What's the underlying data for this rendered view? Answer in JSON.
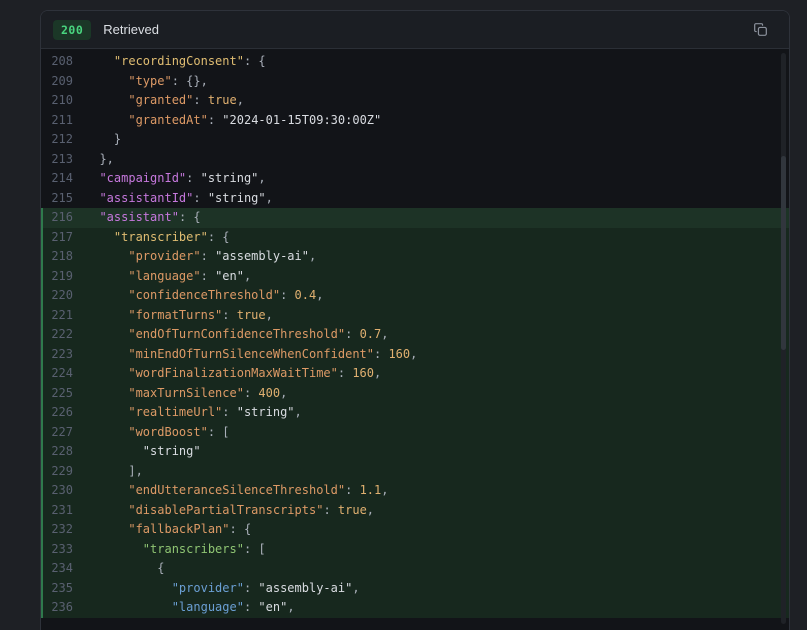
{
  "header": {
    "status_code": "200",
    "status_label": "Retrieved",
    "copy_icon": "copy-icon"
  },
  "colors": {
    "status_green": "#49d57f",
    "badge_bg": "#1b3727",
    "panel_bg": "#121418",
    "header_bg": "#1b1e23",
    "highlight_bg": "#17281e",
    "highlight_first_bg": "#1d3326",
    "highlight_accent": "#2f7a4c",
    "key_level_1": "#c678dd",
    "key_level_2": "#e0bd72",
    "key_level_3": "#dd9a66",
    "key_level_4": "#8fc573",
    "key_level_6": "#6b9fd4",
    "string_value": "#d9dce1",
    "number_value": "#e0b070",
    "punctuation": "#a9afb9",
    "line_number": "#596070"
  },
  "code": {
    "lines": [
      {
        "n": "208",
        "ind": 4,
        "hl": false,
        "first": false,
        "toks": [
          [
            "k2",
            "\"recordingConsent\""
          ],
          [
            "p",
            ": {"
          ]
        ]
      },
      {
        "n": "209",
        "ind": 6,
        "hl": false,
        "first": false,
        "toks": [
          [
            "k3",
            "\"type\""
          ],
          [
            "p",
            ": {},"
          ]
        ]
      },
      {
        "n": "210",
        "ind": 6,
        "hl": false,
        "first": false,
        "toks": [
          [
            "k3",
            "\"granted\""
          ],
          [
            "p",
            ": "
          ],
          [
            "b",
            "true"
          ],
          [
            "p",
            ","
          ]
        ]
      },
      {
        "n": "211",
        "ind": 6,
        "hl": false,
        "first": false,
        "toks": [
          [
            "k3",
            "\"grantedAt\""
          ],
          [
            "p",
            ": "
          ],
          [
            "s",
            "\"2024-01-15T09:30:00Z\""
          ]
        ]
      },
      {
        "n": "212",
        "ind": 4,
        "hl": false,
        "first": false,
        "toks": [
          [
            "p",
            "}"
          ]
        ]
      },
      {
        "n": "213",
        "ind": 2,
        "hl": false,
        "first": false,
        "toks": [
          [
            "p",
            "},"
          ]
        ]
      },
      {
        "n": "214",
        "ind": 2,
        "hl": false,
        "first": false,
        "toks": [
          [
            "k1",
            "\"campaignId\""
          ],
          [
            "p",
            ": "
          ],
          [
            "s",
            "\"string\""
          ],
          [
            "p",
            ","
          ]
        ]
      },
      {
        "n": "215",
        "ind": 2,
        "hl": false,
        "first": false,
        "toks": [
          [
            "k1",
            "\"assistantId\""
          ],
          [
            "p",
            ": "
          ],
          [
            "s",
            "\"string\""
          ],
          [
            "p",
            ","
          ]
        ]
      },
      {
        "n": "216",
        "ind": 2,
        "hl": true,
        "first": true,
        "toks": [
          [
            "k1",
            "\"assistant\""
          ],
          [
            "p",
            ": {"
          ]
        ]
      },
      {
        "n": "217",
        "ind": 4,
        "hl": true,
        "first": false,
        "toks": [
          [
            "k2",
            "\"transcriber\""
          ],
          [
            "p",
            ": {"
          ]
        ]
      },
      {
        "n": "218",
        "ind": 6,
        "hl": true,
        "first": false,
        "toks": [
          [
            "k3",
            "\"provider\""
          ],
          [
            "p",
            ": "
          ],
          [
            "s",
            "\"assembly-ai\""
          ],
          [
            "p",
            ","
          ]
        ]
      },
      {
        "n": "219",
        "ind": 6,
        "hl": true,
        "first": false,
        "toks": [
          [
            "k3",
            "\"language\""
          ],
          [
            "p",
            ": "
          ],
          [
            "s",
            "\"en\""
          ],
          [
            "p",
            ","
          ]
        ]
      },
      {
        "n": "220",
        "ind": 6,
        "hl": true,
        "first": false,
        "toks": [
          [
            "k3",
            "\"confidenceThreshold\""
          ],
          [
            "p",
            ": "
          ],
          [
            "n",
            "0.4"
          ],
          [
            "p",
            ","
          ]
        ]
      },
      {
        "n": "221",
        "ind": 6,
        "hl": true,
        "first": false,
        "toks": [
          [
            "k3",
            "\"formatTurns\""
          ],
          [
            "p",
            ": "
          ],
          [
            "b",
            "true"
          ],
          [
            "p",
            ","
          ]
        ]
      },
      {
        "n": "222",
        "ind": 6,
        "hl": true,
        "first": false,
        "toks": [
          [
            "k3",
            "\"endOfTurnConfidenceThreshold\""
          ],
          [
            "p",
            ": "
          ],
          [
            "n",
            "0.7"
          ],
          [
            "p",
            ","
          ]
        ]
      },
      {
        "n": "223",
        "ind": 6,
        "hl": true,
        "first": false,
        "toks": [
          [
            "k3",
            "\"minEndOfTurnSilenceWhenConfident\""
          ],
          [
            "p",
            ": "
          ],
          [
            "n",
            "160"
          ],
          [
            "p",
            ","
          ]
        ]
      },
      {
        "n": "224",
        "ind": 6,
        "hl": true,
        "first": false,
        "toks": [
          [
            "k3",
            "\"wordFinalizationMaxWaitTime\""
          ],
          [
            "p",
            ": "
          ],
          [
            "n",
            "160"
          ],
          [
            "p",
            ","
          ]
        ]
      },
      {
        "n": "225",
        "ind": 6,
        "hl": true,
        "first": false,
        "toks": [
          [
            "k3",
            "\"maxTurnSilence\""
          ],
          [
            "p",
            ": "
          ],
          [
            "n",
            "400"
          ],
          [
            "p",
            ","
          ]
        ]
      },
      {
        "n": "226",
        "ind": 6,
        "hl": true,
        "first": false,
        "toks": [
          [
            "k3",
            "\"realtimeUrl\""
          ],
          [
            "p",
            ": "
          ],
          [
            "s",
            "\"string\""
          ],
          [
            "p",
            ","
          ]
        ]
      },
      {
        "n": "227",
        "ind": 6,
        "hl": true,
        "first": false,
        "toks": [
          [
            "k3",
            "\"wordBoost\""
          ],
          [
            "p",
            ": ["
          ]
        ]
      },
      {
        "n": "228",
        "ind": 8,
        "hl": true,
        "first": false,
        "toks": [
          [
            "s",
            "\"string\""
          ]
        ]
      },
      {
        "n": "229",
        "ind": 6,
        "hl": true,
        "first": false,
        "toks": [
          [
            "p",
            "],"
          ]
        ]
      },
      {
        "n": "230",
        "ind": 6,
        "hl": true,
        "first": false,
        "toks": [
          [
            "k3",
            "\"endUtteranceSilenceThreshold\""
          ],
          [
            "p",
            ": "
          ],
          [
            "n",
            "1.1"
          ],
          [
            "p",
            ","
          ]
        ]
      },
      {
        "n": "231",
        "ind": 6,
        "hl": true,
        "first": false,
        "toks": [
          [
            "k3",
            "\"disablePartialTranscripts\""
          ],
          [
            "p",
            ": "
          ],
          [
            "b",
            "true"
          ],
          [
            "p",
            ","
          ]
        ]
      },
      {
        "n": "232",
        "ind": 6,
        "hl": true,
        "first": false,
        "toks": [
          [
            "k3",
            "\"fallbackPlan\""
          ],
          [
            "p",
            ": {"
          ]
        ]
      },
      {
        "n": "233",
        "ind": 8,
        "hl": true,
        "first": false,
        "toks": [
          [
            "k4",
            "\"transcribers\""
          ],
          [
            "p",
            ": ["
          ]
        ]
      },
      {
        "n": "234",
        "ind": 10,
        "hl": true,
        "first": false,
        "toks": [
          [
            "p",
            "{"
          ]
        ]
      },
      {
        "n": "235",
        "ind": 12,
        "hl": true,
        "first": false,
        "toks": [
          [
            "k6",
            "\"provider\""
          ],
          [
            "p",
            ": "
          ],
          [
            "s",
            "\"assembly-ai\""
          ],
          [
            "p",
            ","
          ]
        ]
      },
      {
        "n": "236",
        "ind": 12,
        "hl": true,
        "first": false,
        "toks": [
          [
            "k6",
            "\"language\""
          ],
          [
            "p",
            ": "
          ],
          [
            "s",
            "\"en\""
          ],
          [
            "p",
            ","
          ]
        ]
      }
    ]
  }
}
